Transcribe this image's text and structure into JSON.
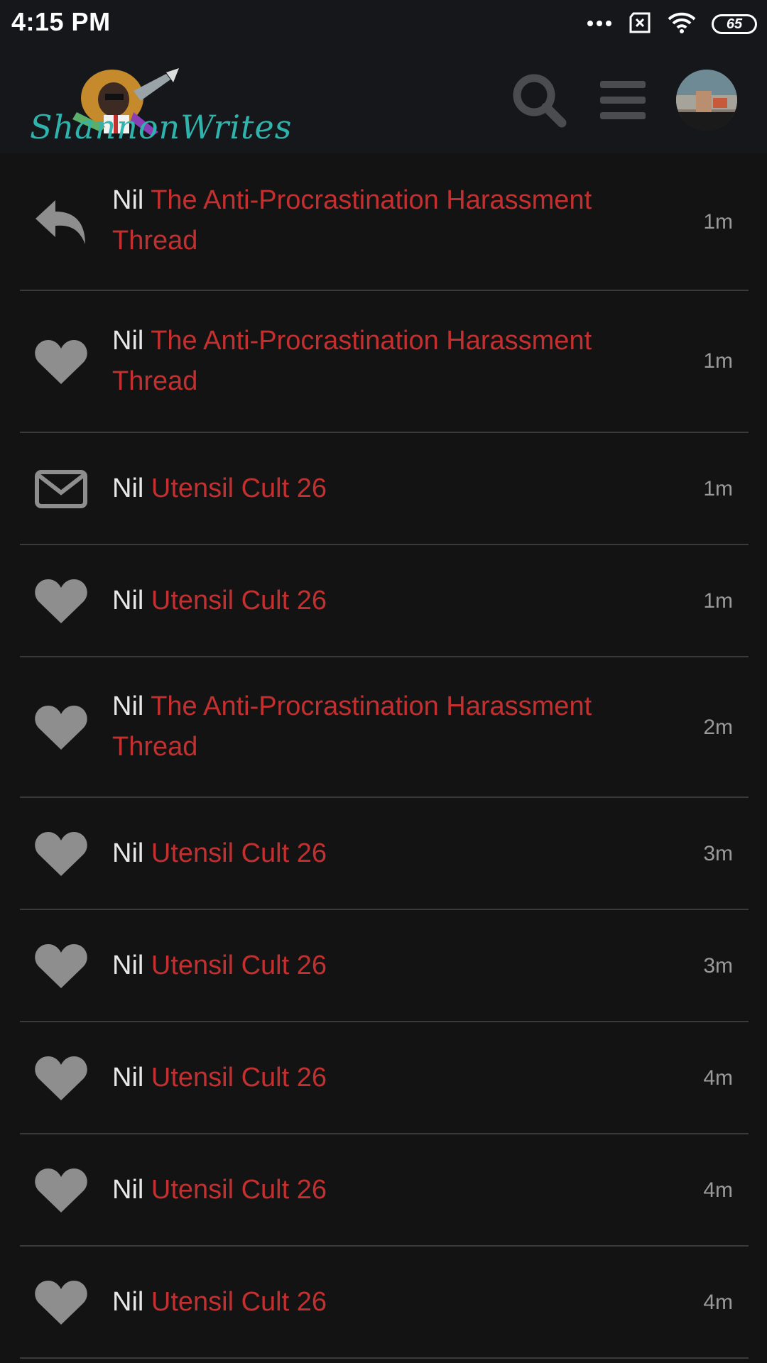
{
  "status_bar": {
    "time": "4:15 PM",
    "battery": "65",
    "icons": [
      "more-dots-icon",
      "sim-error-icon",
      "wifi-icon",
      "battery-icon"
    ]
  },
  "header": {
    "logo_text": "ShannonWrites",
    "search_icon": "search-icon",
    "menu_icon": "hamburger-menu-icon",
    "avatar": "user-avatar"
  },
  "colors": {
    "background": "#131314",
    "header": "#15171b",
    "title_link": "#c3302f",
    "username": "#e8e8e8",
    "icon_gray": "#8e8e8e",
    "time": "#9a9a9a"
  },
  "notifications": [
    {
      "icon": "reply-icon",
      "user": "Nil",
      "title": "The Anti-Procrastination Harassment Thread",
      "time": "1m"
    },
    {
      "icon": "heart-icon",
      "user": "Nil",
      "title": "The Anti-Procrastination Harassment Thread",
      "time": "1m"
    },
    {
      "icon": "envelope-icon",
      "user": "Nil",
      "title": "Utensil Cult 26",
      "time": "1m"
    },
    {
      "icon": "heart-icon",
      "user": "Nil",
      "title": "Utensil Cult 26",
      "time": "1m"
    },
    {
      "icon": "heart-icon",
      "user": "Nil",
      "title": "The Anti-Procrastination Harassment Thread",
      "time": "2m"
    },
    {
      "icon": "heart-icon",
      "user": "Nil",
      "title": "Utensil Cult 26",
      "time": "3m"
    },
    {
      "icon": "heart-icon",
      "user": "Nil",
      "title": "Utensil Cult 26",
      "time": "3m"
    },
    {
      "icon": "heart-icon",
      "user": "Nil",
      "title": "Utensil Cult 26",
      "time": "4m"
    },
    {
      "icon": "heart-icon",
      "user": "Nil",
      "title": "Utensil Cult 26",
      "time": "4m"
    },
    {
      "icon": "heart-icon",
      "user": "Nil",
      "title": "Utensil Cult 26",
      "time": "4m"
    }
  ]
}
